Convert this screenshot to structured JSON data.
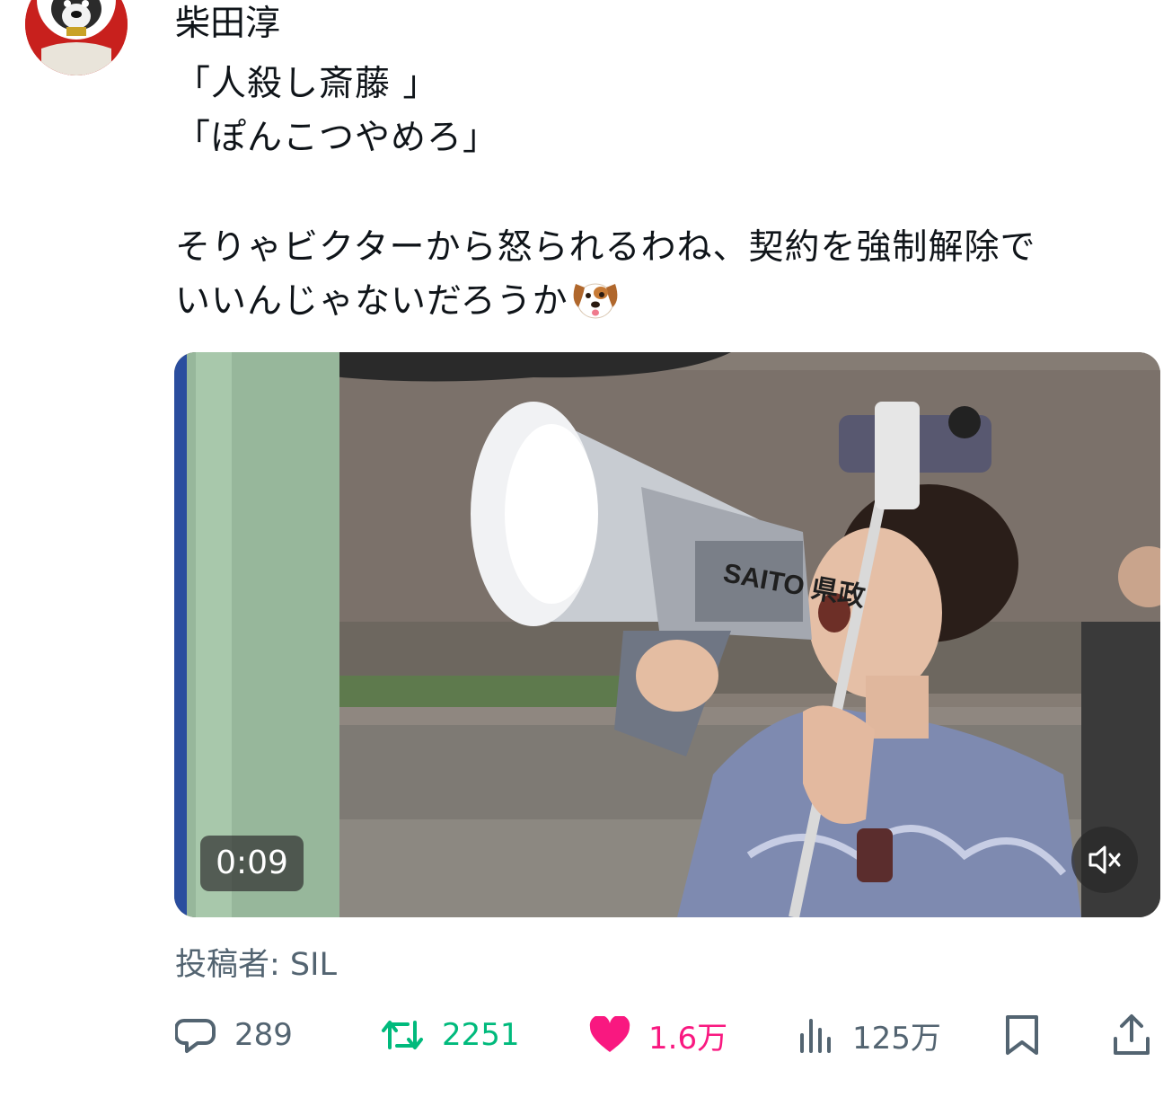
{
  "post": {
    "author": "柴田淳",
    "body_lines": [
      "「人殺し斎藤 」",
      "「ぽんこつやめろ」",
      "",
      "そりゃビクターから怒られるわね、契約を強制解除で",
      "いいんじゃないだろうか"
    ],
    "media": {
      "timestamp": "0:09",
      "megaphone_text": "SAITO 県政"
    },
    "credit": "投稿者: SIL"
  },
  "actions": {
    "replies": "289",
    "retweets": "2251",
    "likes": "1.6万",
    "views": "125万"
  },
  "colors": {
    "retweet": "#00ba7c",
    "like": "#f91880",
    "muted": "#536471"
  },
  "icons": [
    "reply-icon",
    "retweet-icon",
    "heart-icon",
    "views-icon",
    "bookmark-icon",
    "share-icon",
    "mute-icon",
    "dog-face-emoji"
  ]
}
